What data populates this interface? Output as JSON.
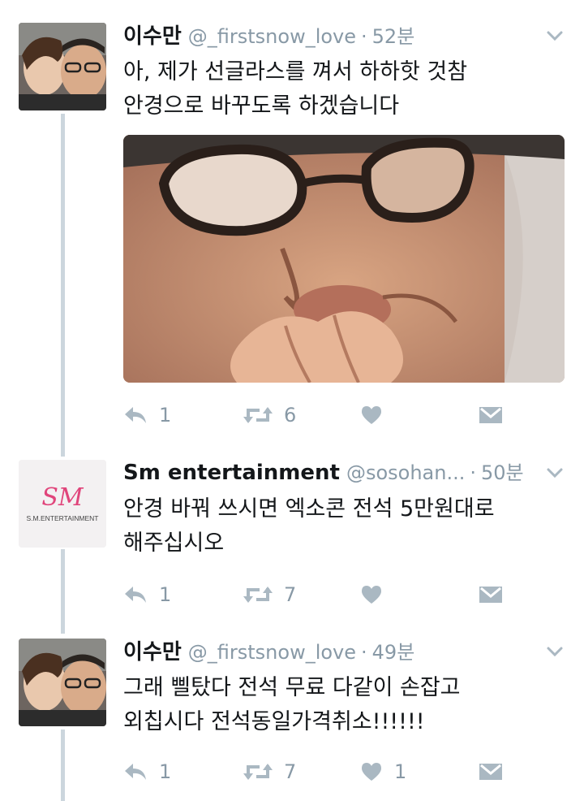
{
  "tweets": [
    {
      "name": "이수만",
      "handle": "@_firstsnow_love",
      "dot": "·",
      "time": "52분",
      "text_lines": [
        "아, 제가 선글라스를 껴서 하하핫 것참",
        "안경으로 바꾸도록 하겠습니다"
      ],
      "reply_count": "1",
      "retweet_count": "6",
      "like_count": ""
    },
    {
      "name": "Sm entertainment",
      "handle": "@sosohan...",
      "dot": "·",
      "time": "50분",
      "text_lines": [
        "안경 바꿔 쓰시면 엑소콘 전석 5만원대로",
        "해주십시오"
      ],
      "reply_count": "1",
      "retweet_count": "7",
      "like_count": "",
      "avatar_logo": "SM",
      "avatar_caption": "S.M.ENTERTAINMENT"
    },
    {
      "name": "이수만",
      "handle": "@_firstsnow_love",
      "dot": "·",
      "time": "49분",
      "text_lines": [
        "그래 삘탔다 전석 무료 다같이 손잡고",
        "외칩시다 전석동일가격취소!!!!!!"
      ],
      "reply_count": "1",
      "retweet_count": "7",
      "like_count": "1"
    }
  ],
  "icons": {
    "reply": "reply-icon",
    "retweet": "retweet-icon",
    "like": "heart-icon",
    "dm": "direct-message-icon",
    "menu": "chevron-down-icon"
  },
  "colors": {
    "icon_gray": "#aab8c2",
    "meta_gray": "#8899a6",
    "thread_line": "#ccd6dd",
    "sm_logo": "#e0457b"
  }
}
